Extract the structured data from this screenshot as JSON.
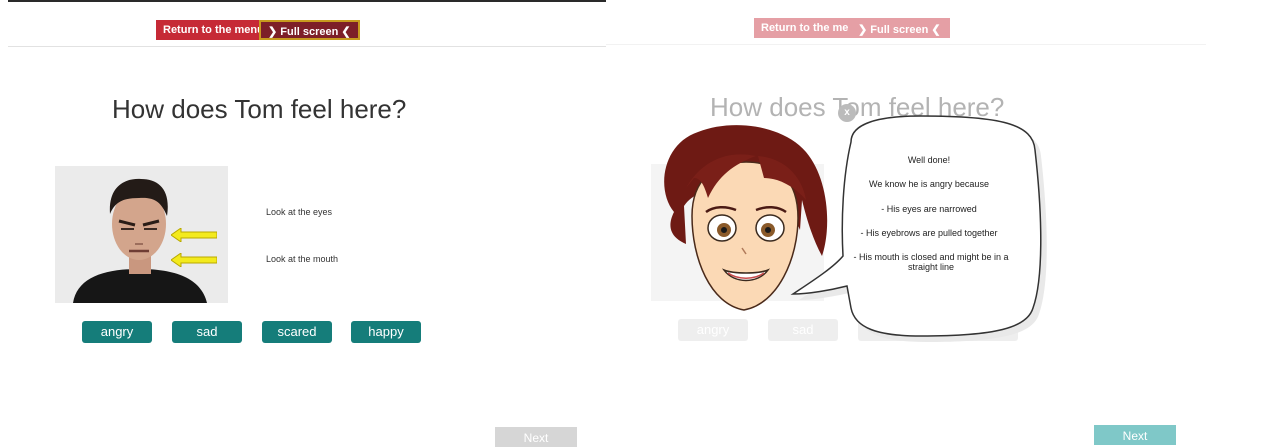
{
  "screens": {
    "left": {
      "return_label": "Return to the menu",
      "full_label": "Full screen",
      "question": "How does Tom feel here?",
      "hint_eyes": "Look at the eyes",
      "hint_mouth": "Look at the mouth",
      "answers": [
        "angry",
        "sad",
        "scared",
        "happy"
      ],
      "next_label": "Next"
    },
    "right": {
      "return_label": "Return to the menu",
      "full_label": "Full screen",
      "question": "How does Tom feel here?",
      "answers_visible": [
        "angry",
        "sad"
      ],
      "next_label": "Next",
      "bubble_close": "x",
      "feedback": {
        "title": "Well done!",
        "reason": "We know he is angry because",
        "points": [
          "- His eyes are narrowed",
          "- His eyebrows are pulled together",
          "- His mouth is closed and might be in a straight line"
        ]
      }
    }
  },
  "colors": {
    "return_button": "#c62a36",
    "full_screen_button": "#7d1f28",
    "answer_button": "#157d7a",
    "next_button_inactive": "#d6d6d6",
    "next_button_active": "#7fc8c8",
    "arrow": "#f3ea1d"
  },
  "icons": {
    "full_screen_left": "chevron-right-icon",
    "full_screen_right": "chevron-left-icon",
    "hint_arrow": "arrow-left-icon"
  }
}
